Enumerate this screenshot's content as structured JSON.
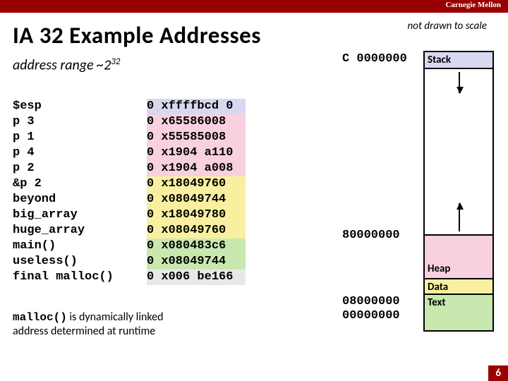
{
  "header": {
    "institution": "Carnegie Mellon"
  },
  "title": "IA 32 Example Addresses",
  "not_drawn": "not drawn to scale",
  "subtitle_prefix": "address range ~2",
  "subtitle_exp": "32",
  "rows": [
    {
      "name": "$esp",
      "addr": "0 xffffbcd 0",
      "cls": "bg-lav"
    },
    {
      "name": "p 3",
      "addr": "0 x65586008",
      "cls": "bg-pink"
    },
    {
      "name": "p 1",
      "addr": "0 x55585008",
      "cls": "bg-pink"
    },
    {
      "name": "p 4",
      "addr": "0 x1904 a110",
      "cls": "bg-pink"
    },
    {
      "name": "p 2",
      "addr": "0 x1904 a008",
      "cls": "bg-pink"
    },
    {
      "name": "&p 2",
      "addr": "0 x18049760",
      "cls": "bg-yel"
    },
    {
      "name": "beyond",
      "addr": "0 x08049744",
      "cls": "bg-yel"
    },
    {
      "name": "big_array",
      "addr": "0 x18049780",
      "cls": "bg-yel"
    },
    {
      "name": "huge_array",
      "addr": "0 x08049760",
      "cls": "bg-yel"
    },
    {
      "name": "main()",
      "addr": "0 x080483c6",
      "cls": "bg-grn"
    },
    {
      "name": "useless()",
      "addr": "0 x08049744",
      "cls": "bg-grn"
    },
    {
      "name": "final malloc()",
      "addr": "0 x006 be166",
      "cls": "bg-gray"
    }
  ],
  "note_mono": "malloc()",
  "note_rest1": " is dynamically linked",
  "note_rest2": "address determined at runtime",
  "addresses": {
    "top": "C 0000000",
    "mid": "80000000",
    "low1": "08000000",
    "low2": "00000000"
  },
  "regions": {
    "stack": "Stack",
    "heap": "Heap",
    "data": "Data",
    "text": "Text"
  },
  "page_number": "6"
}
